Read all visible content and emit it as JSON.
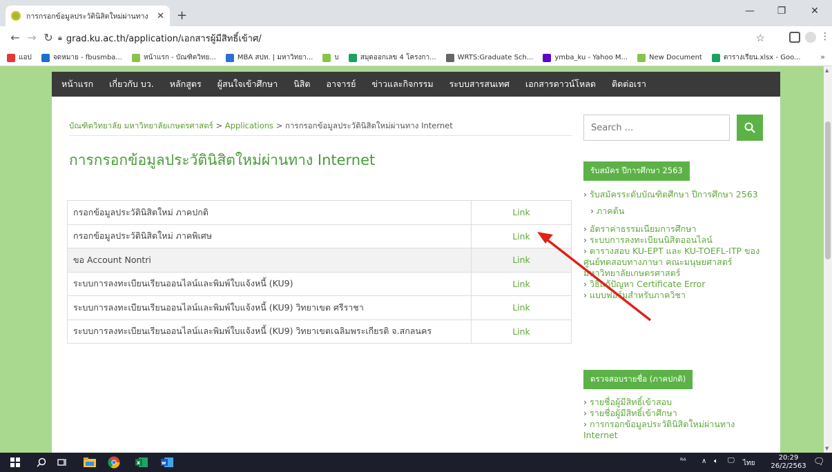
{
  "browser": {
    "tab_title": "การกรอกข้อมูลประวัตินิสิตใหม่ผ่านทาง",
    "url": "grad.ku.ac.th/application/เอกสารผู้มีสิทธิ์เข้าศ/",
    "bookmarks": [
      {
        "label": "แอป",
        "color": "#e53935"
      },
      {
        "label": "จดหมาย - fbusmba...",
        "color": "#1e6ec8"
      },
      {
        "label": "หน้าแรก - บัณฑิตวิทย...",
        "color": "#8bc34a"
      },
      {
        "label": "MBA สปท. | มหาวิทยา...",
        "color": "#2a6fd6"
      },
      {
        "label": "บ",
        "color": "#8bc34a"
      },
      {
        "label": "สมุดออกเลข 4 โครงกา...",
        "color": "#1aa260"
      },
      {
        "label": "WRTS:Graduate Sch...",
        "color": "#666666"
      },
      {
        "label": "ymba_ku - Yahoo M...",
        "color": "#5f01d1"
      },
      {
        "label": "New Document",
        "color": "#8bc34a"
      },
      {
        "label": "ตารางเรียน.xlsx - Goo...",
        "color": "#1aa260"
      }
    ],
    "more": "»"
  },
  "nav": {
    "items": [
      "หน้าแรก",
      "เกี่ยวกับ บว.",
      "หลักสูตร",
      "ผู้สนใจเข้าศึกษา",
      "นิสิต",
      "อาจารย์",
      "ข่าวและกิจกรรม",
      "ระบบสารสนเทศ",
      "เอกสารดาวน์โหลด",
      "ติดต่อเรา"
    ]
  },
  "breadcrumb": {
    "home": "บัณฑิตวิทยาลัย มหาวิทยาลัยเกษตรศาสตร์",
    "sep1": " > ",
    "section": "Applications",
    "sep2": " > ",
    "current": "การกรอกข้อมูลประวัตินิสิตใหม่ผ่านทาง Internet"
  },
  "page_title": "การกรอกข้อมูลประวัตินิสิตใหม่ผ่านทาง Internet",
  "links_table": {
    "rows": [
      {
        "label": "กรอกข้อมูลประวัตินิสิตใหม่ ภาคปกติ",
        "link": "Link"
      },
      {
        "label": "กรอกข้อมูลประวัตินิสิตใหม่ ภาคพิเศษ",
        "link": "Link"
      },
      {
        "label": "ขอ Account Nontri",
        "link": "Link"
      },
      {
        "label": "ระบบการลงทะเบียนเรียนออนไลน์และพิมพ์ใบแจ้งหนี้ (KU9)",
        "link": "Link"
      },
      {
        "label": "ระบบการลงทะเบียนเรียนออนไลน์และพิมพ์ใบแจ้งหนี้ (KU9) วิทยาเขต ศรีราชา",
        "link": "Link"
      },
      {
        "label": "ระบบการลงทะเบียนเรียนออนไลน์และพิมพ์ใบแจ้งหนี้ (KU9) วิทยาเขตเฉลิมพระเกียรติ จ.สกลนคร",
        "link": "Link"
      }
    ]
  },
  "sidebar": {
    "search_placeholder": "Search ...",
    "section1_title": "รับสมัคร ปีการศึกษา 2563",
    "section1_items": [
      {
        "text": "รับสมัครระดับบัณฑิตศึกษา ปีการศึกษา 2563",
        "sub": false
      },
      {
        "text": "ภาคต้น",
        "sub": true
      },
      {
        "text": "อัตราค่าธรรมเนียมการศึกษา",
        "sub": false
      },
      {
        "text": "ระบบการลงทะเบียนนิสิตออนไลน์",
        "sub": false
      },
      {
        "text": "ตารางสอบ KU-EPT และ KU-TOEFL-ITP ของศูนย์ทดสอบทางภาษา คณะมนุษยศาสตร์ มหาวิทยาลัยเกษตรศาสตร์",
        "sub": false
      },
      {
        "text": "วิธีแก้ปัญหา Certificate Error",
        "sub": false
      },
      {
        "text": "แบบฟอร์มสำหรับภาควิชา",
        "sub": false
      }
    ],
    "section2_title": "ตรวจสอบรายชื่อ (ภาคปกติ)",
    "section2_items": [
      {
        "text": "รายชื่อผู้มีสิทธิ์เข้าสอบ",
        "sub": false
      },
      {
        "text": "รายชื่อผู้มีสิทธิ์เข้าศึกษา",
        "sub": false
      },
      {
        "text": "การกรอกข้อมูลประวัตินิสิตใหม่ผ่านทาง Internet",
        "sub": false
      }
    ]
  },
  "annotation": {
    "arrow_color": "#e0201b"
  },
  "taskbar": {
    "language": "ไทย",
    "time": "20:29",
    "date": "26/2/2563"
  }
}
